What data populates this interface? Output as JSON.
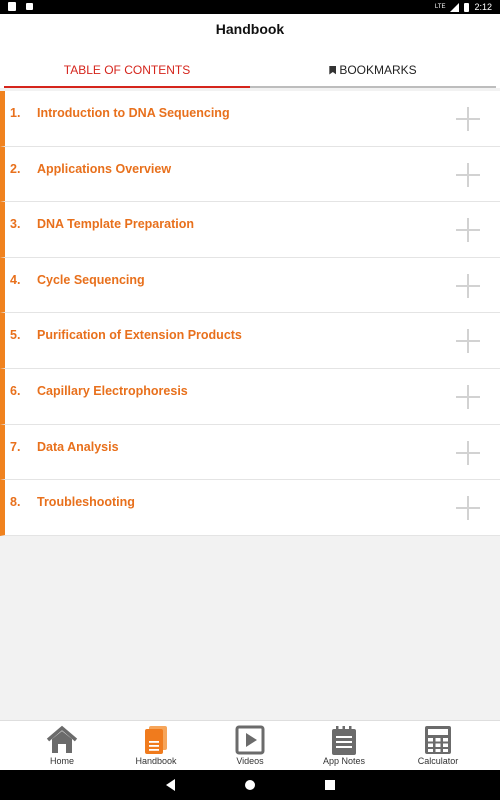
{
  "status_bar": {
    "network": "LTE",
    "time": "2:12"
  },
  "app_bar": {
    "title": "Handbook"
  },
  "tabs": [
    {
      "label": "TABLE OF CONTENTS",
      "active": true
    },
    {
      "label": "BOOKMARKS",
      "active": false
    }
  ],
  "toc": [
    {
      "number": "1.",
      "title": "Introduction to DNA Sequencing"
    },
    {
      "number": "2.",
      "title": "Applications Overview"
    },
    {
      "number": "3.",
      "title": "DNA Template Preparation"
    },
    {
      "number": "4.",
      "title": "Cycle Sequencing"
    },
    {
      "number": "5.",
      "title": "Purification of Extension Products"
    },
    {
      "number": "6.",
      "title": "Capillary Electrophoresis"
    },
    {
      "number": "7.",
      "title": "Data Analysis"
    },
    {
      "number": "8.",
      "title": "Troubleshooting"
    }
  ],
  "bottom_nav": [
    {
      "label": "Home",
      "icon": "home-icon",
      "active": false
    },
    {
      "label": "Handbook",
      "icon": "handbook-icon",
      "active": true
    },
    {
      "label": "Videos",
      "icon": "video-icon",
      "active": false
    },
    {
      "label": "App Notes",
      "icon": "app-notes-icon",
      "active": false
    },
    {
      "label": "Calculator",
      "icon": "calculator-icon",
      "active": false
    }
  ],
  "colors": {
    "accent": "#d5251c",
    "toc_orange": "#e8701c",
    "toc_bar": "#f0821e",
    "nav_icon": "#6b6b6b",
    "nav_icon_active": "#f07b1d"
  }
}
